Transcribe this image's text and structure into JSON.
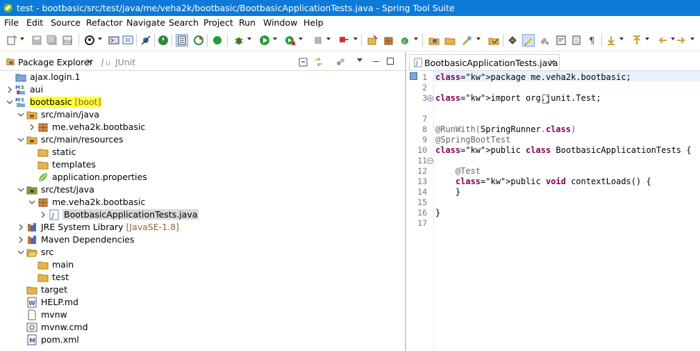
{
  "window": {
    "title": "test - bootbasic/src/test/java/me/veha2k/bootbasic/BootbasicApplicationTests.java - Spring Tool Suite"
  },
  "menu": [
    "File",
    "Edit",
    "Source",
    "Refactor",
    "Navigate",
    "Search",
    "Project",
    "Run",
    "Window",
    "Help"
  ],
  "toolbar": {
    "icons": [
      "new-icon",
      "save-icon",
      "save-all-icon",
      "binary-icon",
      "profile-icon",
      "terminal-icon",
      "skip-breakpoints-icon",
      "spring-boot-icon",
      "toggle-breadcrumb-icon",
      "refresh-icon",
      "start-server-icon",
      "debug-icon",
      "run-icon",
      "run-external-icon",
      "stop-icon",
      "publish-icon",
      "new-java-project-icon",
      "new-package-icon",
      "new-class-icon",
      "open-type-icon",
      "open-folder-icon",
      "search-icon",
      "open-task-icon",
      "mark-occurrences-icon",
      "highlight-icon",
      "annotation-icon",
      "word-wrap-icon",
      "block-select-icon",
      "show-whitespace-icon",
      "next-annotation-icon",
      "prev-annotation-icon",
      "back-icon",
      "forward-icon"
    ]
  },
  "left_pane": {
    "tabs": [
      "Package Explorer",
      "JUnit"
    ],
    "tree": [
      {
        "label": "ajax.login.1",
        "decoration": "",
        "icon": "project-icon",
        "expanded": null,
        "highlighted": false
      },
      {
        "label": "aui",
        "decoration": "",
        "icon": "maven-spring-project-icon",
        "expanded": false,
        "highlighted": false
      },
      {
        "label": "bootbasic",
        "decoration": "[boot]",
        "icon": "maven-spring-project-icon",
        "expanded": true,
        "highlighted": true
      },
      {
        "label": "src/main/java",
        "decoration": "",
        "icon": "source-folder-icon",
        "expanded": true,
        "highlighted": false
      },
      {
        "label": "me.veha2k.bootbasic",
        "decoration": "",
        "icon": "package-icon",
        "expanded": false,
        "highlighted": false
      },
      {
        "label": "src/main/resources",
        "decoration": "",
        "icon": "source-folder-icon",
        "expanded": true,
        "highlighted": false
      },
      {
        "label": "static",
        "decoration": "",
        "icon": "folder-icon",
        "expanded": null,
        "highlighted": false
      },
      {
        "label": "templates",
        "decoration": "",
        "icon": "folder-icon",
        "expanded": null,
        "highlighted": false
      },
      {
        "label": "application.properties",
        "decoration": "",
        "icon": "properties-file-icon",
        "expanded": null,
        "highlighted": false
      },
      {
        "label": "src/test/java",
        "decoration": "",
        "icon": "source-folder-icon",
        "expanded": true,
        "highlighted": false
      },
      {
        "label": "me.veha2k.bootbasic",
        "decoration": "",
        "icon": "package-icon",
        "expanded": true,
        "highlighted": false
      },
      {
        "label": "BootbasicApplicationTests.java",
        "decoration": "",
        "icon": "java-file-icon",
        "expanded": false,
        "highlighted": false,
        "selected": true
      },
      {
        "label": "JRE System Library",
        "decoration": "[JavaSE-1.8]",
        "icon": "library-icon",
        "expanded": false,
        "highlighted": false
      },
      {
        "label": "Maven Dependencies",
        "decoration": "",
        "icon": "library-icon",
        "expanded": false,
        "highlighted": false
      },
      {
        "label": "src",
        "decoration": "",
        "icon": "folder-open-icon",
        "expanded": true,
        "highlighted": false
      },
      {
        "label": "main",
        "decoration": "",
        "icon": "folder-icon",
        "expanded": null,
        "highlighted": false
      },
      {
        "label": "test",
        "decoration": "",
        "icon": "folder-icon",
        "expanded": null,
        "highlighted": false
      },
      {
        "label": "target",
        "decoration": "",
        "icon": "folder-icon",
        "expanded": null,
        "highlighted": false
      },
      {
        "label": "HELP.md",
        "decoration": "",
        "icon": "markdown-file-icon",
        "expanded": null,
        "highlighted": false
      },
      {
        "label": "mvnw",
        "decoration": "",
        "icon": "file-icon",
        "expanded": null,
        "highlighted": false
      },
      {
        "label": "mvnw.cmd",
        "decoration": "",
        "icon": "cmd-file-icon",
        "expanded": null,
        "highlighted": false
      },
      {
        "label": "pom.xml",
        "decoration": "",
        "icon": "xml-file-icon",
        "expanded": null,
        "highlighted": false
      }
    ]
  },
  "editor": {
    "tab_label": "BootbasicApplicationTests.java",
    "lines": [
      {
        "n": "1",
        "text": "package me.veha2k.bootbasic;"
      },
      {
        "n": "2",
        "text": ""
      },
      {
        "n": "3",
        "text": "import org.junit.Test;"
      },
      {
        "n": "7",
        "text": ""
      },
      {
        "n": "8",
        "text": "@RunWith(SpringRunner.class)"
      },
      {
        "n": "9",
        "text": "@SpringBootTest"
      },
      {
        "n": "10",
        "text": "public class BootbasicApplicationTests {"
      },
      {
        "n": "11",
        "text": ""
      },
      {
        "n": "12",
        "text": "    @Test"
      },
      {
        "n": "13",
        "text": "    public void contextLoads() {"
      },
      {
        "n": "14",
        "text": "    }"
      },
      {
        "n": "15",
        "text": ""
      },
      {
        "n": "16",
        "text": "}"
      },
      {
        "n": "17",
        "text": ""
      }
    ]
  },
  "colors": {
    "titlebar": "#0c7ad9",
    "keyword": "#7f0055",
    "annotation": "#646464",
    "highlight": "#ffff33",
    "decoration": "#8b6a3a"
  }
}
